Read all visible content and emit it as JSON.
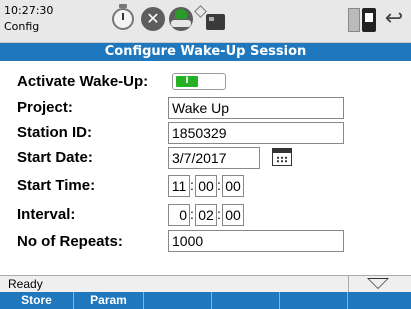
{
  "header": {
    "clock": "10:27:30",
    "screen_name": "Config",
    "icons": [
      "timer-icon",
      "close-icon",
      "globe-icon",
      "pin-icon",
      "card-icon",
      "sd-card-icon",
      "battery-icon",
      "back-arrow-icon"
    ]
  },
  "title": "Configure Wake-Up Session",
  "form": {
    "activate_label": "Activate Wake-Up:",
    "activate_state": "I",
    "project_label": "Project:",
    "project_value": "Wake Up",
    "station_label": "Station ID:",
    "station_value": "1850329",
    "start_date_label": "Start Date:",
    "start_date_value": "3/7/2017",
    "start_time_label": "Start Time:",
    "start_time": {
      "hh": "11",
      "mm": "00",
      "ss": "00"
    },
    "interval_label": "Interval:",
    "interval": {
      "hh": "0",
      "mm": "02",
      "ss": "00"
    },
    "repeats_label": "No of Repeats:",
    "repeats_value": "1000",
    "time_separator": ":"
  },
  "status": {
    "text": "Ready"
  },
  "softkeys": [
    "Store",
    "Param",
    "",
    "",
    "",
    "",
    ""
  ],
  "colors": {
    "accent": "#1f78bd",
    "toggle_on": "#25b025"
  }
}
